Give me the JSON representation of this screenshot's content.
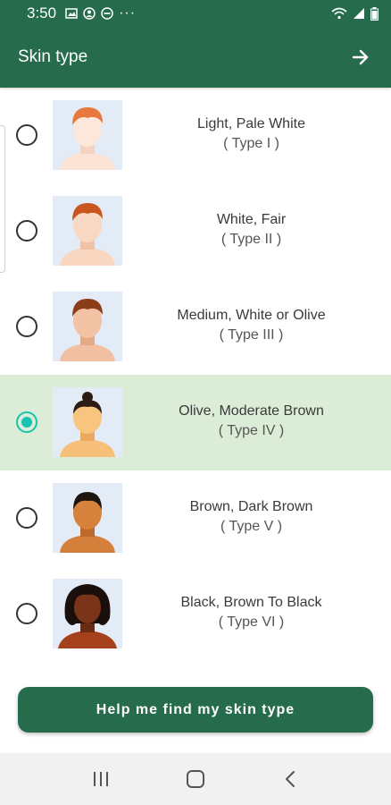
{
  "status": {
    "time": "3:50",
    "more": "···"
  },
  "appbar": {
    "title": "Skin type",
    "next_icon": "arrow-right-icon"
  },
  "colors": {
    "primary": "#256b4c",
    "accent": "#17c2b2",
    "selected_row": "#dcedd7"
  },
  "skin_types": [
    {
      "name": "Light, Pale White",
      "type": "( Type I )",
      "selected": false
    },
    {
      "name": "White, Fair",
      "type": "( Type II )",
      "selected": false
    },
    {
      "name": "Medium, White or Olive",
      "type": "( Type III )",
      "selected": false
    },
    {
      "name": "Olive, Moderate Brown",
      "type": "( Type IV )",
      "selected": true
    },
    {
      "name": "Brown, Dark Brown",
      "type": "( Type V )",
      "selected": false
    },
    {
      "name": "Black, Brown To Black",
      "type": "( Type VI )",
      "selected": false
    }
  ],
  "help_button": {
    "label": "Help me find my skin type"
  },
  "navbar": {
    "recents_icon": "recents-icon",
    "home_icon": "home-icon",
    "back_icon": "back-icon"
  }
}
